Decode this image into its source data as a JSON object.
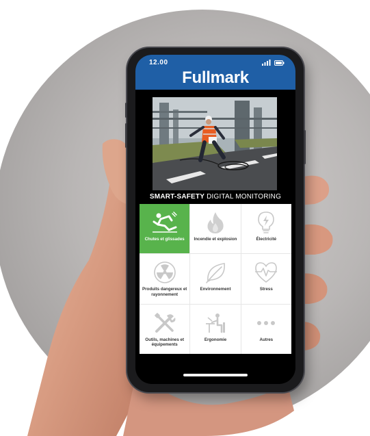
{
  "status": {
    "time": "12.00"
  },
  "app": {
    "brand": "Fullmark"
  },
  "hero": {
    "caption_bold": "SMART-SAFETY",
    "caption_rest": " DIGITAL MONITORING"
  },
  "categories": [
    {
      "label": "Chutes et glissades",
      "icon": "slip-fall-icon",
      "active": true
    },
    {
      "label": "Incendie et explosion",
      "icon": "flame-icon",
      "active": false
    },
    {
      "label": "Électricité",
      "icon": "lightbulb-icon",
      "active": false
    },
    {
      "label": "Produits dangereux et rayonnement",
      "icon": "radiation-icon",
      "active": false
    },
    {
      "label": "Environnement",
      "icon": "leaf-icon",
      "active": false
    },
    {
      "label": "Stress",
      "icon": "heart-pulse-icon",
      "active": false
    },
    {
      "label": "Outils, machines et équipements",
      "icon": "tools-icon",
      "active": false
    },
    {
      "label": "Ergonomie",
      "icon": "desk-worker-icon",
      "active": false
    },
    {
      "label": "Autres",
      "icon": "more-dots-icon",
      "active": false
    }
  ],
  "colors": {
    "header": "#1f5fa6",
    "active_tile": "#58b34c",
    "icon_grey": "#c8c8c8"
  }
}
